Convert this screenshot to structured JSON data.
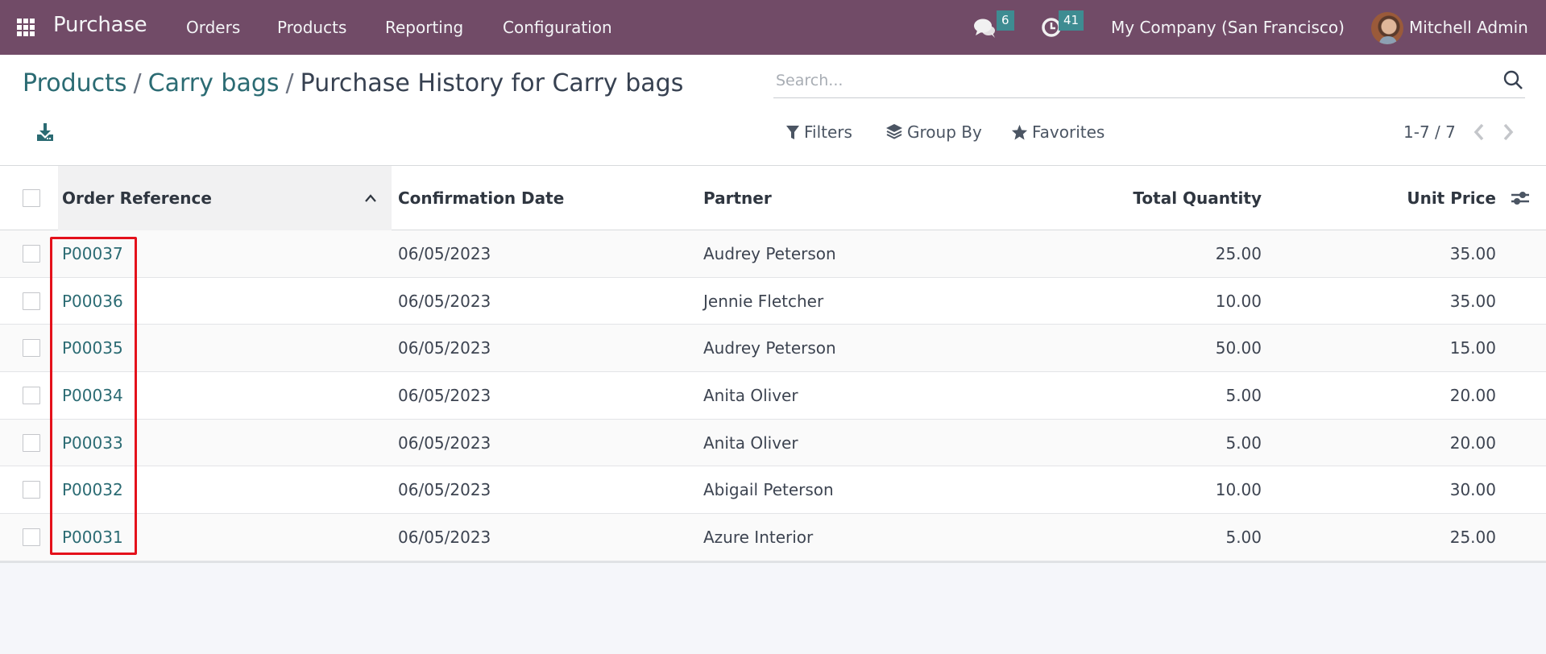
{
  "navbar": {
    "app_name": "Purchase",
    "menu": [
      {
        "label": "Orders"
      },
      {
        "label": "Products"
      },
      {
        "label": "Reporting"
      },
      {
        "label": "Configuration"
      }
    ],
    "messages_count": "6",
    "activities_count": "41",
    "company": "My Company (San Francisco)",
    "user": "Mitchell Admin",
    "brand_color": "#714B67"
  },
  "breadcrumb": {
    "items": [
      {
        "label": "Products"
      },
      {
        "label": "Carry bags"
      }
    ],
    "separator": "/",
    "current": "Purchase History for Carry bags"
  },
  "search": {
    "placeholder": "Search...",
    "value": ""
  },
  "controls": {
    "filters_label": "Filters",
    "group_by_label": "Group By",
    "favorites_label": "Favorites",
    "pager": "1-7 / 7"
  },
  "table": {
    "columns": [
      {
        "label": "Order Reference",
        "sorted": "ascending"
      },
      {
        "label": "Confirmation Date"
      },
      {
        "label": "Partner"
      },
      {
        "label": "Total Quantity"
      },
      {
        "label": "Unit Price"
      }
    ],
    "rows": [
      {
        "order_ref": "P00037",
        "date": "06/05/2023",
        "partner": "Audrey Peterson",
        "qty": "25.00",
        "unit_price": "35.00"
      },
      {
        "order_ref": "P00036",
        "date": "06/05/2023",
        "partner": "Jennie Fletcher",
        "qty": "10.00",
        "unit_price": "35.00"
      },
      {
        "order_ref": "P00035",
        "date": "06/05/2023",
        "partner": "Audrey Peterson",
        "qty": "50.00",
        "unit_price": "15.00"
      },
      {
        "order_ref": "P00034",
        "date": "06/05/2023",
        "partner": "Anita Oliver",
        "qty": "5.00",
        "unit_price": "20.00"
      },
      {
        "order_ref": "P00033",
        "date": "06/05/2023",
        "partner": "Anita Oliver",
        "qty": "5.00",
        "unit_price": "20.00"
      },
      {
        "order_ref": "P00032",
        "date": "06/05/2023",
        "partner": "Abigail Peterson",
        "qty": "10.00",
        "unit_price": "30.00"
      },
      {
        "order_ref": "P00031",
        "date": "06/05/2023",
        "partner": "Azure Interior",
        "qty": "5.00",
        "unit_price": "25.00"
      }
    ]
  },
  "annotation": {
    "highlight_color": "#E4111B",
    "highlights": "order_reference_column"
  }
}
